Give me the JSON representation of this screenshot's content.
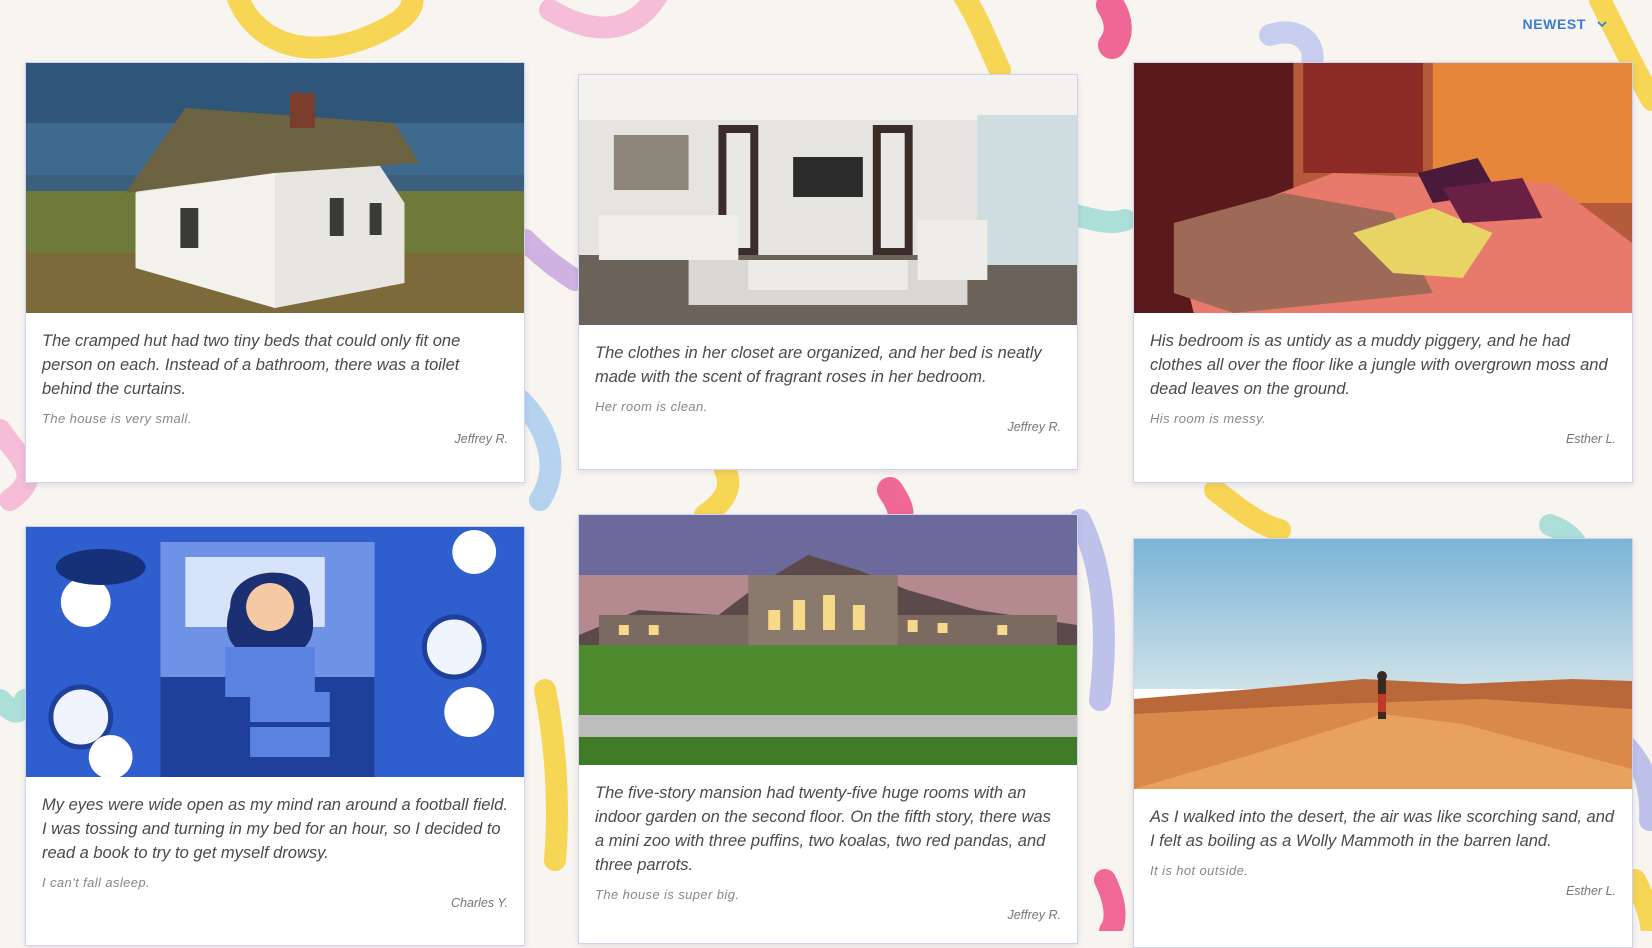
{
  "sort": {
    "label": "NEWEST",
    "icon": "chevron-down-icon"
  },
  "colors": {
    "accent": "#3b7ed1",
    "page_background": "#f8f4ef",
    "card_border": "#cfd3f2"
  },
  "cards": [
    {
      "image": "white-wooden-hut-photo",
      "story": "The cramped hut had two tiny beds that could only fit one person on each. Instead of a bathroom, there was a toilet behind the curtains.",
      "summary": "The house is very small.",
      "author": "Jeffrey R."
    },
    {
      "image": "modern-living-room-photo",
      "story": "The clothes in her closet are organized, and her bed is neatly made with the scent of fragrant roses in her bedroom.",
      "summary": "Her room is clean.",
      "author": "Jeffrey R."
    },
    {
      "image": "messy-bedroom-photo",
      "story": "His bedroom is as untidy as a muddy piggery, and he had clothes all over the floor like a jungle with overgrown moss and dead leaves on the ground.",
      "summary": "His room is messy.",
      "author": "Esther L."
    },
    {
      "image": "sleepless-woman-illustration",
      "story": "My eyes were wide open as my mind ran around a football field. I was tossing and turning in my bed for an hour, so I decided to read a book to try to get myself drowsy.",
      "summary": "I can't fall asleep.",
      "author": "Charles Y."
    },
    {
      "image": "mansion-at-dusk-photo",
      "story": "The five-story mansion had twenty-five huge rooms with an indoor garden on the second floor. On the fifth story, there was a mini zoo with three puffins, two koalas, two red pandas, and three parrots.",
      "summary": "The house is super big.",
      "author": "Jeffrey R."
    },
    {
      "image": "desert-walker-photo",
      "story": "As I walked into the desert, the air was like scorching sand, and I felt as boiling as a Wolly Mammoth in the barren land.",
      "summary": "It is hot outside.",
      "author": "Esther L."
    }
  ]
}
